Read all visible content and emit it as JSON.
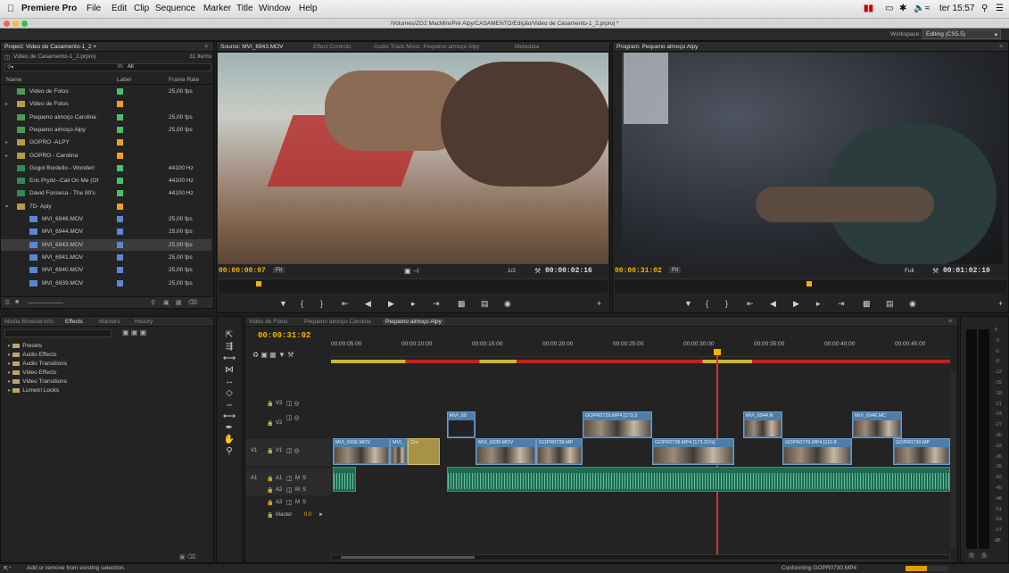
{
  "menubar": {
    "app": "Premiere Pro",
    "items": [
      "File",
      "Edit",
      "Clip",
      "Sequence",
      "Marker",
      "Title",
      "Window",
      "Help"
    ],
    "clock": "ter 15:57"
  },
  "titlebar": {
    "path": "/Volumes/ZG2 MacMini/Pré Alpy/CASAMENTO/Edição/Video de Casamento-1_2.prproj *"
  },
  "workspace": {
    "label": "Workspace:",
    "value": "Editing (CS5.5)"
  },
  "project": {
    "tab": "Project: Video de Casamento-1_2 ×",
    "file": "Video de Casamento-1_2.prproj",
    "count": "31 Items",
    "in_label": "In:",
    "in_value": "All",
    "cols": {
      "name": "Name",
      "label": "Label",
      "frame_rate": "Frame Rate"
    },
    "items": [
      {
        "name": "Video de Fotos",
        "color": "#47c26b",
        "rate": "25,00 fps",
        "type": "seq",
        "indent": 0
      },
      {
        "name": "Video de Fotos",
        "color": "#f0a020",
        "rate": "",
        "type": "bin",
        "indent": 0
      },
      {
        "name": "Pequeno almoço Carolina",
        "color": "#47c26b",
        "rate": "25,00 fps",
        "type": "seq",
        "indent": 0
      },
      {
        "name": "Pequeno almoço Alpy",
        "color": "#47c26b",
        "rate": "25,00 fps",
        "type": "seq",
        "indent": 0
      },
      {
        "name": "GOPRO -ALPY",
        "color": "#f0a020",
        "rate": "",
        "type": "bin",
        "indent": 0
      },
      {
        "name": "GOPRO - Carolina",
        "color": "#f0a020",
        "rate": "",
        "type": "bin",
        "indent": 0
      },
      {
        "name": "Gogol Bordello - Wonderl",
        "color": "#47c26b",
        "rate": "44100 Hz",
        "type": "aud",
        "indent": 0
      },
      {
        "name": "Eric Prydz--Call On Me (Of",
        "color": "#47c26b",
        "rate": "44100 Hz",
        "type": "aud",
        "indent": 0
      },
      {
        "name": "David Fonseca - The 80's",
        "color": "#47c26b",
        "rate": "44100 Hz",
        "type": "aud",
        "indent": 0
      },
      {
        "name": "7D- Aply",
        "color": "#f0a020",
        "rate": "",
        "type": "bin",
        "indent": 0
      },
      {
        "name": "MVI_6946.MOV",
        "color": "#5a86d6",
        "rate": "25,00 fps",
        "type": "clip",
        "indent": 1
      },
      {
        "name": "MVI_6944.MOV",
        "color": "#5a86d6",
        "rate": "25,00 fps",
        "type": "clip",
        "indent": 1
      },
      {
        "name": "MVI_6943.MOV",
        "color": "#5a86d6",
        "rate": "25,00 fps",
        "type": "clip",
        "indent": 1
      },
      {
        "name": "MVI_6941.MOV",
        "color": "#5a86d6",
        "rate": "25,00 fps",
        "type": "clip",
        "indent": 1
      },
      {
        "name": "MVI_6940.MOV",
        "color": "#5a86d6",
        "rate": "25,00 fps",
        "type": "clip",
        "indent": 1
      },
      {
        "name": "MVI_6939.MOV",
        "color": "#5a86d6",
        "rate": "25,00 fps",
        "type": "clip",
        "indent": 1
      }
    ]
  },
  "source": {
    "tabs": [
      "Source: MVI_6943.MOV",
      "Effect Controls",
      "Audio Track Mixer: Pequeno almoço Alpy",
      "Metadata"
    ],
    "tc_in": "00:00:00:07",
    "fit": "Fit",
    "res": "1/2",
    "tc_dur": "00:00:02:16"
  },
  "program": {
    "tab": "Program: Pequeno almoço Alpy",
    "tc_in": "00:00:31:02",
    "fit": "Fit",
    "res": "Full",
    "tc_dur": "00:01:02:10"
  },
  "effects": {
    "tabs": [
      "Media Browser",
      "Info",
      "Effects",
      "Markers",
      "History"
    ],
    "items": [
      "Presets",
      "Audio Effects",
      "Audio Transitions",
      "Video Effects",
      "Video Transitions",
      "Lumetri Looks"
    ]
  },
  "timeline": {
    "tabs": [
      "Video de Fotos",
      "Pequeno almoço Carolina",
      "Pequeno almoço Alpy"
    ],
    "tc": "00:00:31:02",
    "ruler": [
      "00:00:05:00",
      "00:00:10:00",
      "00:00:15:00",
      "00:00:20:00",
      "00:00:25:00",
      "00:00:30:00",
      "00:00:35:00",
      "00:00:40:00",
      "00:00:45:00"
    ],
    "tracks": {
      "v3": "V3",
      "v2": "V2",
      "v1": "V1",
      "a1": "A1",
      "a2": "A2",
      "a3": "A3",
      "master": "Master",
      "master_val": "0.0",
      "ms": "M",
      "s": "S"
    },
    "v2_clips": [
      "MVI_69",
      "GOPR0729.MP4 [173.3",
      "MVI_6944.N",
      "MVI_6946.MC"
    ],
    "v1_clips": [
      "MVI_6936.MOV",
      "MVI_",
      "Cro",
      "MVI_6939.MOV",
      "GOPR0728.MP",
      "GOPR0728.MP4 [173.31%]",
      "GOPR0729.MP4 [110.8",
      "GOPR0730.MP"
    ]
  },
  "meters": [
    "0",
    "-3",
    "-6",
    "-9",
    "-12",
    "-15",
    "-18",
    "-21",
    "-24",
    "-27",
    "-30",
    "-33",
    "-36",
    "-39",
    "-42",
    "-45",
    "-48",
    "-51",
    "-54",
    "-57",
    "dB"
  ],
  "meter_btns": [
    "S",
    "S"
  ],
  "status": {
    "left": "Add or remove from existing selection.",
    "right": "Conforming GOPR0730.MP4"
  }
}
